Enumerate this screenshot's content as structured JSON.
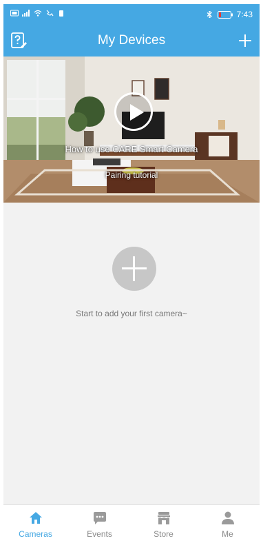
{
  "colors": {
    "accent": "#45a8e3",
    "inactive": "#8a8a8a",
    "background": "#f2f2f2"
  },
  "status_bar": {
    "left_icons": [
      "hd-icon",
      "signal-icon",
      "wifi-icon",
      "call-icon",
      "battery-small-icon"
    ],
    "right_icons": [
      "bluetooth-icon",
      "battery-icon"
    ],
    "time": "7:43"
  },
  "header": {
    "title": "My Devices",
    "left_icon": "help-icon",
    "right_icon": "plus-icon"
  },
  "banner": {
    "title": "How to use CARE Smart Camera",
    "subtitle": "Pairing tutorial",
    "icon": "play-icon"
  },
  "empty_state": {
    "message": "Start to add your first camera~",
    "icon": "plus-icon"
  },
  "bottom_nav": {
    "items": [
      {
        "label": "Cameras",
        "icon": "home-icon",
        "active": true
      },
      {
        "label": "Events",
        "icon": "message-icon",
        "active": false
      },
      {
        "label": "Store",
        "icon": "store-icon",
        "active": false
      },
      {
        "label": "Me",
        "icon": "person-icon",
        "active": false
      }
    ]
  }
}
